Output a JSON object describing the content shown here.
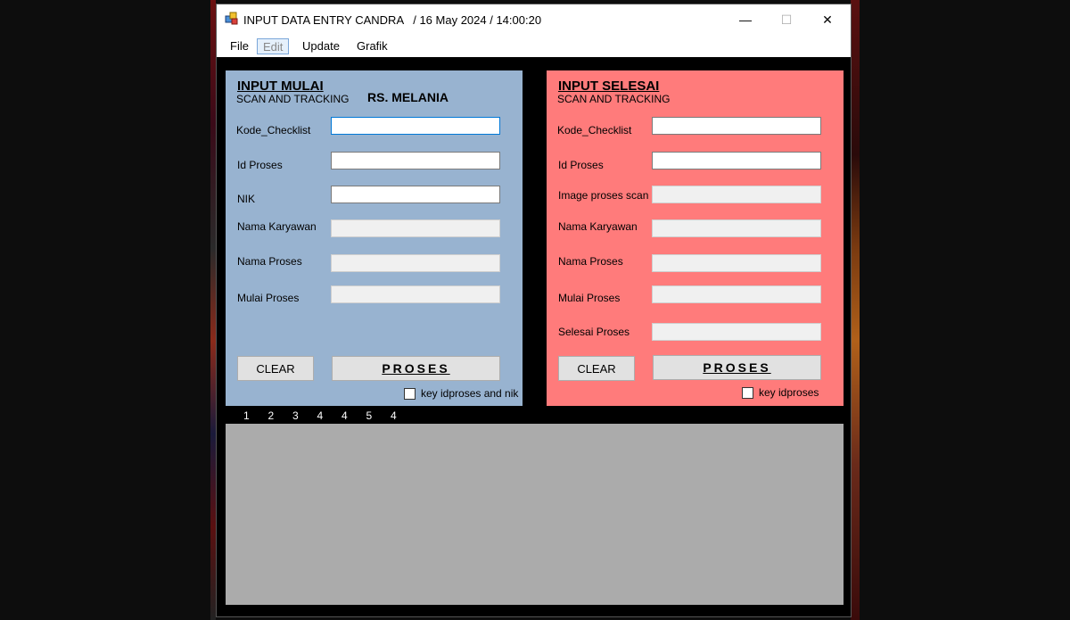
{
  "window": {
    "title": "INPUT DATA ENTRY CANDRA   / 16 May 2024 / 14:00:20",
    "controls": {
      "minimize": "—",
      "maximize": "☐",
      "close": "✕"
    }
  },
  "menu": {
    "file": "File",
    "edit": "Edit",
    "update": "Update",
    "grafik": "Grafik"
  },
  "left_panel": {
    "title": "INPUT MULAI",
    "subtitle": "SCAN AND TRACKING",
    "hospital": "RS. MELANIA",
    "fields": [
      {
        "label": "Kode_Checklist",
        "value": ""
      },
      {
        "label": "Id Proses",
        "value": ""
      },
      {
        "label": "NIK",
        "value": ""
      },
      {
        "label": "Nama Karyawan",
        "value": ""
      },
      {
        "label": "Nama Proses",
        "value": ""
      },
      {
        "label": "Mulai Proses",
        "value": ""
      }
    ],
    "clear_label": "CLEAR",
    "proses_label": "PROSES",
    "checkbox_label": "key idproses and nik",
    "checkbox_checked": false
  },
  "right_panel": {
    "title": "INPUT SELESAI",
    "subtitle": "SCAN AND TRACKING",
    "fields": [
      {
        "label": "Kode_Checklist",
        "value": ""
      },
      {
        "label": "Id Proses",
        "value": ""
      },
      {
        "label": "Image proses scan",
        "value": ""
      },
      {
        "label": "Nama Karyawan",
        "value": ""
      },
      {
        "label": "Nama Proses",
        "value": ""
      },
      {
        "label": "Mulai Proses",
        "value": ""
      },
      {
        "label": "Selesai Proses",
        "value": ""
      }
    ],
    "clear_label": "CLEAR",
    "proses_label": "PROSES",
    "checkbox_label": "key idproses",
    "checkbox_checked": false
  },
  "counters": [
    "1",
    "2",
    "3",
    "4",
    "4",
    "5",
    "4"
  ],
  "colors": {
    "left_panel_bg": "#98b3d0",
    "right_panel_bg": "#ff7b7b",
    "grid_bg": "#ababab"
  }
}
